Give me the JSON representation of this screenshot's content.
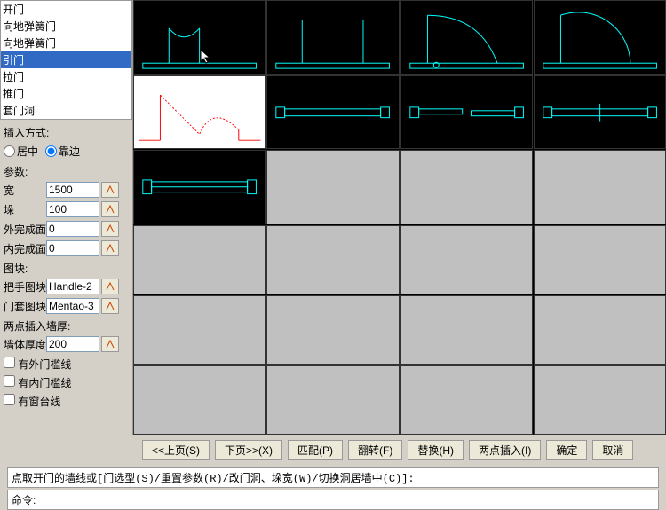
{
  "tree": {
    "items": [
      "开门",
      "向地弹簧门",
      "向地弹簧门",
      "引门",
      "拉门",
      "推门",
      "套门洞"
    ],
    "selected_index": 3
  },
  "insert_mode": {
    "label": "插入方式:",
    "opt_center": "居中",
    "opt_edge": "靠边"
  },
  "params_header": "参数:",
  "params": {
    "width": {
      "label": "宽",
      "value": "1500"
    },
    "height": {
      "label": "垛",
      "value": "100"
    },
    "outer": {
      "label": "外完成面",
      "value": "0"
    },
    "inner": {
      "label": "内完成面",
      "value": "0"
    }
  },
  "blocks_header": "图块:",
  "blocks": {
    "handle": {
      "label": "把手图块",
      "value": "Handle-2"
    },
    "mentao": {
      "label": "门套图块",
      "value": "Mentao-3"
    }
  },
  "wall_header": "两点插入墙厚:",
  "wall": {
    "label": "墙体厚度",
    "value": "200"
  },
  "checkboxes": {
    "outer_sill": "有外门槛线",
    "inner_sill": "有内门槛线",
    "window_sill": "有窗台线"
  },
  "buttons": {
    "prev": "<<上页(S)",
    "next": "下页>>(X)",
    "match": "匹配(P)",
    "flip": "翻转(F)",
    "replace": "替换(H)",
    "two_point": "两点插入(I)",
    "ok": "确定",
    "cancel": "取消"
  },
  "cmdline": "点取开门的墙线或[门选型(S)/重置参数(R)/改门洞、垛宽(W)/切换洞居墙中(C)]:",
  "cmd_prompt": "命令:"
}
